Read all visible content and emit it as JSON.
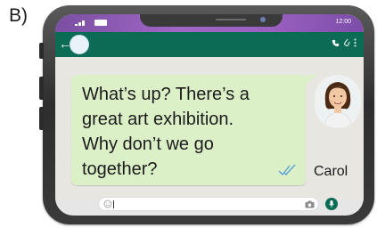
{
  "panel_label": "B)",
  "status": {
    "time": "12:00"
  },
  "message": {
    "lines": [
      "What’s up? There’s a",
      "great art exhibition.",
      "Why don’t we go",
      "together?"
    ]
  },
  "contact": {
    "name": "Carol"
  },
  "colors": {
    "appbar": "#0b6b55",
    "bubble": "#dcf0c8",
    "statusbar": "#9a5fc0"
  },
  "icons": [
    "back-arrow-icon",
    "call-icon",
    "attach-icon",
    "menu-icon",
    "read-receipt-icon",
    "emoji-icon",
    "camera-icon",
    "mic-icon"
  ]
}
